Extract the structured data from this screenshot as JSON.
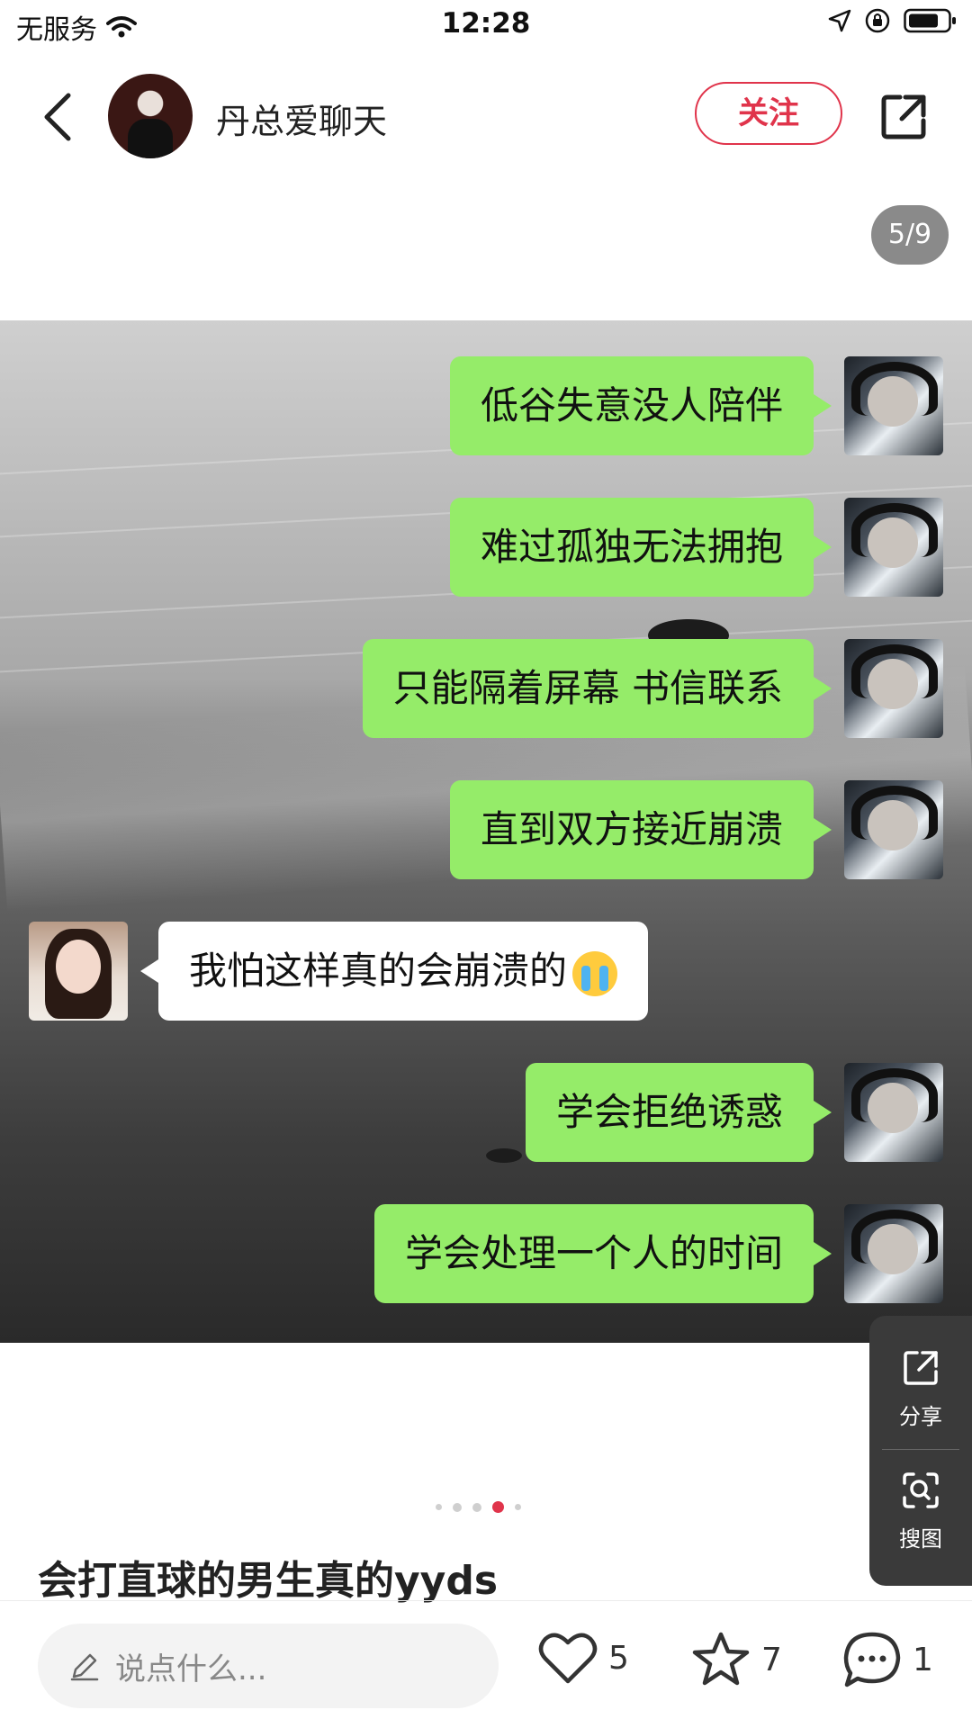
{
  "status_bar": {
    "carrier": "无服务",
    "time": "12:28"
  },
  "header": {
    "username": "丹总爱聊天",
    "follow_label": "关注"
  },
  "page_indicator": "5/9",
  "chat": [
    {
      "side": "right",
      "text": "低谷失意没人陪伴"
    },
    {
      "side": "right",
      "text": "难过孤独无法拥抱"
    },
    {
      "side": "right",
      "text": "只能隔着屏幕 书信联系"
    },
    {
      "side": "right",
      "text": "直到双方接近崩溃"
    },
    {
      "side": "left",
      "text": "我怕这样真的会崩溃的"
    },
    {
      "side": "right",
      "text": "学会拒绝诱惑"
    },
    {
      "side": "right",
      "text": "学会处理一个人的时间"
    }
  ],
  "side_panel": {
    "share_label": "分享",
    "search_image_label": "搜图"
  },
  "carousel": {
    "total": 5,
    "active_index": 3
  },
  "post_title": "会打直球的男生真的yyds",
  "bottom_bar": {
    "comment_placeholder": "说点什么...",
    "likes": "5",
    "favorites": "7",
    "comments": "1"
  },
  "colors": {
    "accent": "#e0344b",
    "bubble_green": "#95ec69"
  }
}
